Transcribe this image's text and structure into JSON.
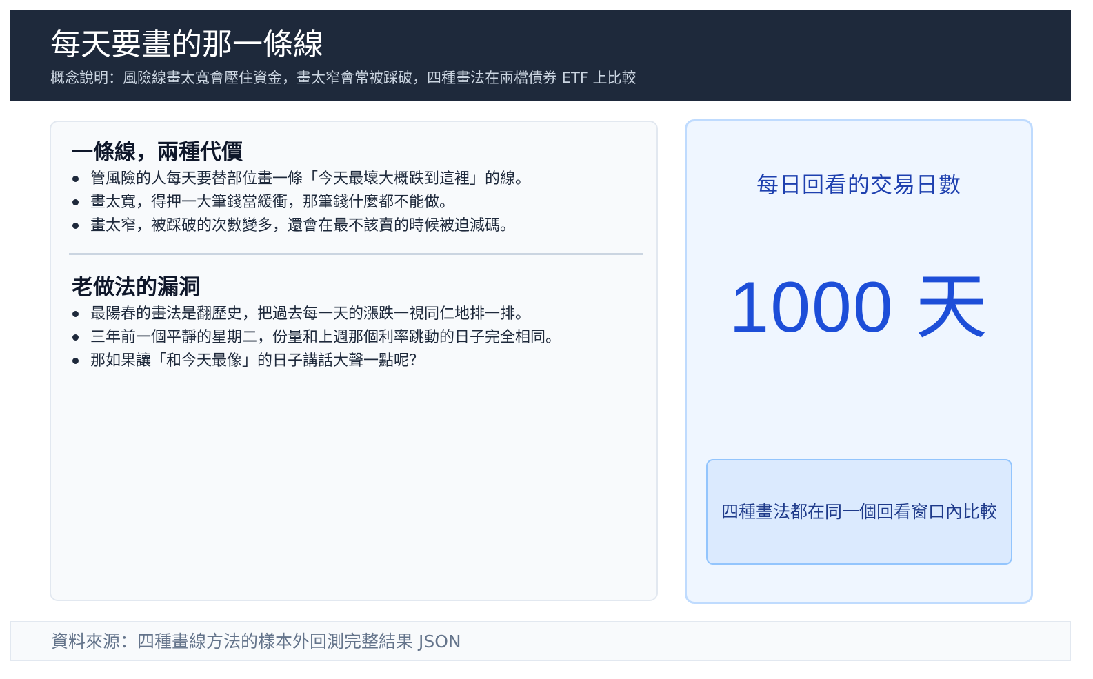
{
  "header": {
    "title": "每天要畫的那一條線",
    "subtitle": "概念說明：風險線畫太寬會壓住資金，畫太窄會常被踩破，四種畫法在兩檔債券 ETF 上比較"
  },
  "sections": [
    {
      "title": "一條線，兩種代價",
      "bullets": [
        "管風險的人每天要替部位畫一條「今天最壞大概跌到這裡」的線。",
        "畫太寬，得押一大筆錢當緩衝，那筆錢什麼都不能做。",
        "畫太窄，被踩破的次數變多，還會在最不該賣的時候被迫減碼。"
      ]
    },
    {
      "title": "老做法的漏洞",
      "bullets": [
        "最陽春的畫法是翻歷史，把過去每一天的漲跌一視同仁地排一排。",
        "三年前一個平靜的星期二，份量和上週那個利率跳動的日子完全相同。",
        "那如果讓「和今天最像」的日子講話大聲一點呢？"
      ]
    }
  ],
  "metric": {
    "label": "每日回看的交易日數",
    "value": "1000 天",
    "note": "四種畫法都在同一個回看窗口內比較"
  },
  "footer": {
    "source": "資料來源：四種畫線方法的樣本外回測完整結果 JSON"
  },
  "colors": {
    "header_bg": "#1e293b",
    "accent": "#1d4ed8",
    "card_bg": "#f8fafc",
    "metric_card_bg": "#eff6ff"
  }
}
